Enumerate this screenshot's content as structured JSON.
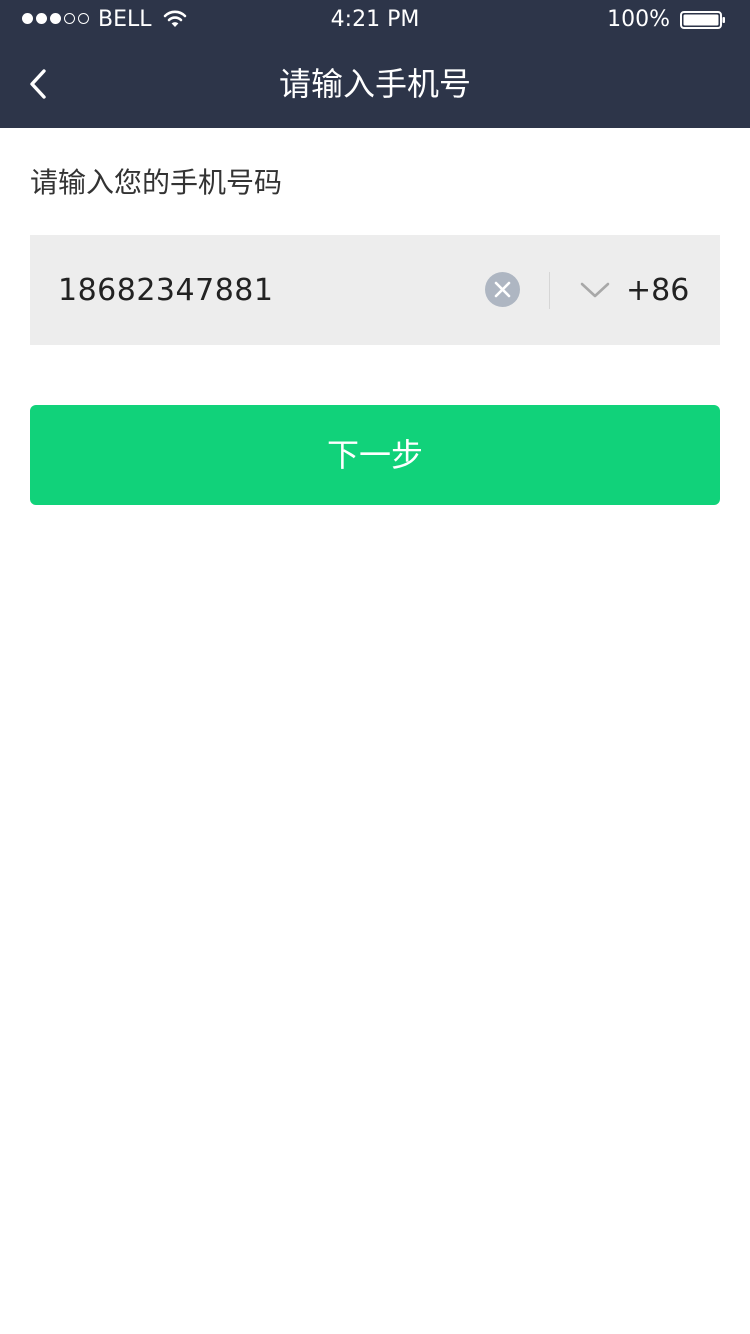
{
  "status_bar": {
    "carrier": "BELL",
    "time": "4:21 PM",
    "battery_percent": "100%",
    "battery_level": 1.0,
    "signal_strength": 3,
    "signal_total": 5,
    "icons": [
      "wifi-icon",
      "battery-icon"
    ]
  },
  "nav": {
    "title": "请输入手机号",
    "back_icon": "chevron-left-icon"
  },
  "form": {
    "prompt": "请输入您的手机号码",
    "phone_value": "18682347881",
    "clear_icon": "clear-icon",
    "dropdown_icon": "chevron-down-icon",
    "country_code": "+86"
  },
  "actions": {
    "next_label": "下一步"
  },
  "colors": {
    "header_bg": "#2d3549",
    "button_green": "#11d27a",
    "input_bg": "#ededed",
    "clear_icon_bg": "#aeb6c2"
  }
}
